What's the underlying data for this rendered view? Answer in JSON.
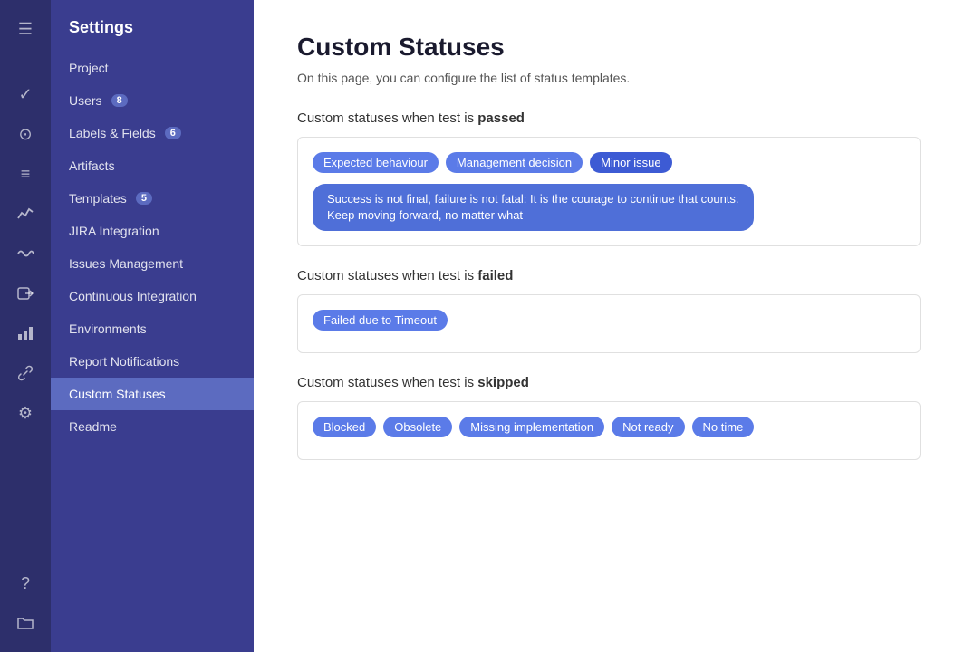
{
  "app": {
    "title": "Settings"
  },
  "iconRail": {
    "icons": [
      {
        "name": "menu-icon",
        "symbol": "☰"
      },
      {
        "name": "check-icon",
        "symbol": "✓"
      },
      {
        "name": "play-circle-icon",
        "symbol": "▶"
      },
      {
        "name": "list-icon",
        "symbol": "☰"
      },
      {
        "name": "graph-icon",
        "symbol": "∿"
      },
      {
        "name": "wave-icon",
        "symbol": "〜"
      },
      {
        "name": "arrow-right-box-icon",
        "symbol": "⇥"
      },
      {
        "name": "bar-chart-icon",
        "symbol": "▦"
      },
      {
        "name": "link-icon",
        "symbol": "🔗"
      },
      {
        "name": "gear-icon",
        "symbol": "⚙"
      },
      {
        "name": "question-icon",
        "symbol": "?"
      },
      {
        "name": "folder-icon",
        "symbol": "🗀"
      }
    ]
  },
  "sidebar": {
    "title": "Settings",
    "items": [
      {
        "label": "Project",
        "badge": null,
        "active": false
      },
      {
        "label": "Users",
        "badge": "8",
        "active": false
      },
      {
        "label": "Labels & Fields",
        "badge": "6",
        "active": false
      },
      {
        "label": "Artifacts",
        "badge": null,
        "active": false
      },
      {
        "label": "Templates",
        "badge": "5",
        "active": false
      },
      {
        "label": "JIRA Integration",
        "badge": null,
        "active": false
      },
      {
        "label": "Issues Management",
        "badge": null,
        "active": false
      },
      {
        "label": "Continuous Integration",
        "badge": null,
        "active": false
      },
      {
        "label": "Environments",
        "badge": null,
        "active": false
      },
      {
        "label": "Report Notifications",
        "badge": null,
        "active": false
      },
      {
        "label": "Custom Statuses",
        "badge": null,
        "active": true
      },
      {
        "label": "Readme",
        "badge": null,
        "active": false
      }
    ]
  },
  "main": {
    "pageTitle": "Custom Statuses",
    "pageDesc": "On this page, you can configure the list of status templates.",
    "sections": [
      {
        "title": "Custom statuses when test is ",
        "statusWord": "passed",
        "tags": [
          "Expected behaviour",
          "Management decision",
          "Minor issue"
        ],
        "quote": "Success is not final, failure is not fatal: It is the courage to continue that counts.\nKeep moving forward, no matter what"
      },
      {
        "title": "Custom statuses when test is ",
        "statusWord": "failed",
        "tags": [
          "Failed due to Timeout"
        ],
        "quote": null
      },
      {
        "title": "Custom statuses when test is ",
        "statusWord": "skipped",
        "tags": [
          "Blocked",
          "Obsolete",
          "Missing implementation",
          "Not ready",
          "No time"
        ],
        "quote": null
      }
    ]
  }
}
